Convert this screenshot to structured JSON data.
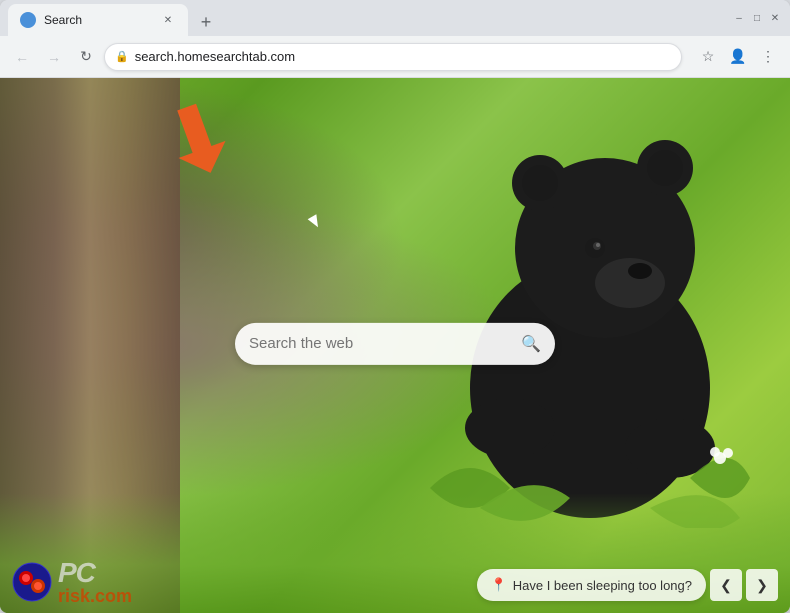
{
  "browser": {
    "tab": {
      "title": "Search",
      "favicon": "globe"
    },
    "new_tab_label": "+",
    "window_controls": {
      "minimize": "–",
      "maximize": "□",
      "close": "✕"
    },
    "nav": {
      "back_label": "←",
      "forward_label": "→",
      "refresh_label": "↻",
      "url": "search.homesearchtab.com",
      "lock_icon": "🔒",
      "bookmark_icon": "☆",
      "profile_icon": "👤",
      "menu_icon": "⋮"
    }
  },
  "page": {
    "search_placeholder": "Search the web",
    "search_icon": "🔍"
  },
  "bottom_bar": {
    "suggestion_icon": "📍",
    "suggestion_text": "Have I been sleeping too long?",
    "prev_label": "❮",
    "next_label": "❯"
  },
  "logo": {
    "text": "PC",
    "domain": "risk.com"
  },
  "arrow": {
    "color": "#e85c20"
  }
}
